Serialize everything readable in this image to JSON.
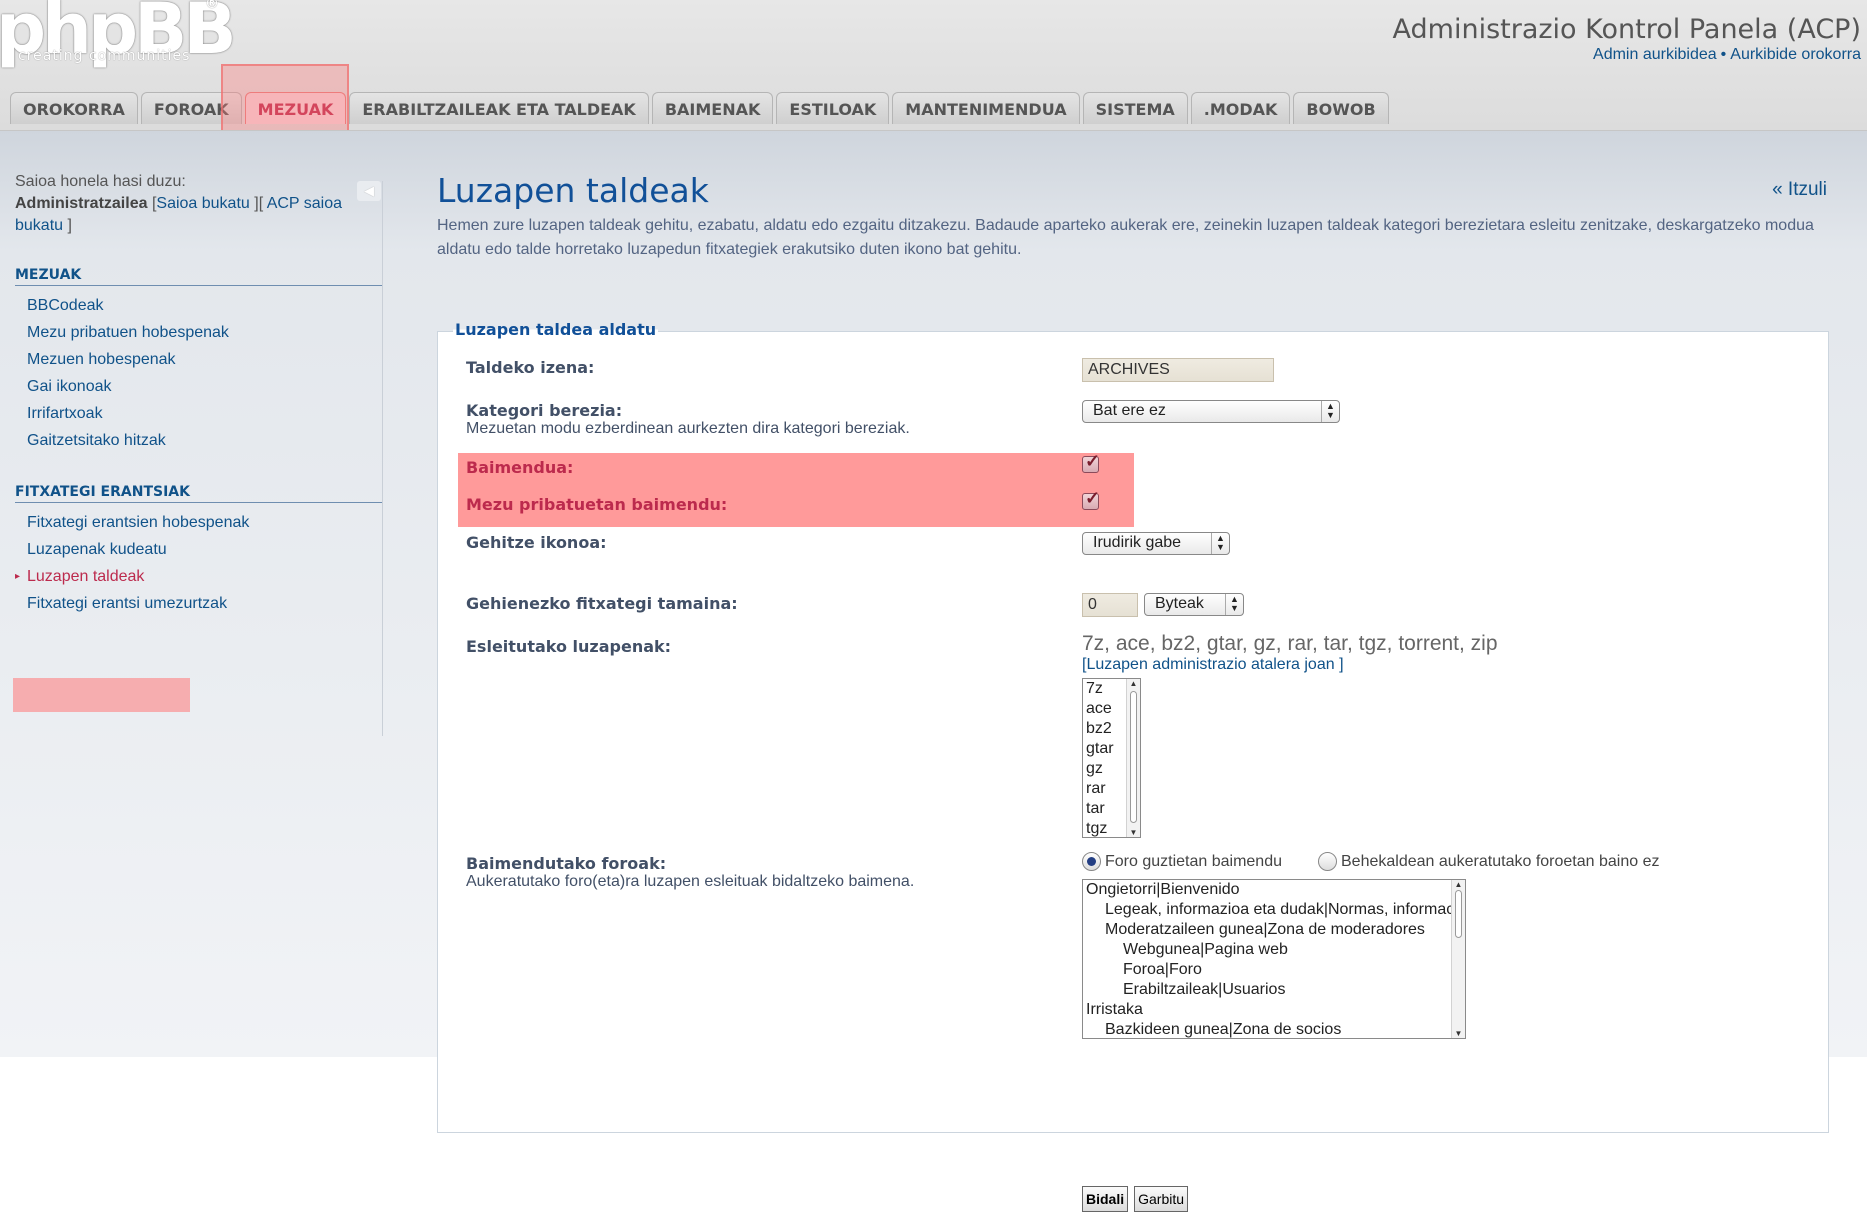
{
  "header": {
    "logo_text": "phpBB",
    "logo_reg": "®",
    "logo_tagline": "creating communities",
    "title": "Administrazio Kontrol Panela (ACP)",
    "links": [
      "Admin aurkibidea",
      "Aurkibide orokorra"
    ],
    "link_separator": "•"
  },
  "tabs": [
    {
      "label": "OROKORRA"
    },
    {
      "label": "FOROAK"
    },
    {
      "label": "MEZUAK",
      "active": true
    },
    {
      "label": "ERABILTZAILEAK ETA TALDEAK"
    },
    {
      "label": "BAIMENAK"
    },
    {
      "label": "ESTILOAK"
    },
    {
      "label": "MANTENIMENDUA"
    },
    {
      "label": "SISTEMA"
    },
    {
      "label": ".MODAK"
    },
    {
      "label": "BOWOB"
    }
  ],
  "sidebar": {
    "collapse_glyph": "◀",
    "login_prefix": "Saioa honela hasi duzu:",
    "username": "Administratzailea",
    "bracket_open": "[",
    "logout": "Saioa bukatu",
    "bracket_mid": "][",
    "acp_logout": "ACP saioa bukatu",
    "bracket_close": "]",
    "blocks": [
      {
        "heading": "MEZUAK",
        "items": [
          "BBCodeak",
          "Mezu pribatuen hobespenak",
          "Mezuen hobespenak",
          "Gai ikonoak",
          "Irrifartxoak",
          "Gaitzetsitako hitzak"
        ]
      },
      {
        "heading": "FITXATEGI ERANTSIAK",
        "items": [
          "Fitxategi erantsien hobespenak",
          "Luzapenak kudeatu",
          "Luzapen taldeak",
          "Fitxategi erantsi umezurtzak"
        ],
        "active_index": 2
      }
    ]
  },
  "main": {
    "title": "Luzapen taldeak",
    "back_link": "« Itzuli",
    "description": "Hemen zure luzapen taldeak gehitu, ezabatu, aldatu edo ezgaitu ditzakezu. Badaude aparteko aukerak ere, zeinekin luzapen taldeak kategori berezietara esleitu zenitzake, deskargatzeko modua aldatu edo talde horretako luzapedun fitxategiek erakutsiko duten ikono bat gehitu.",
    "fieldset_legend": "Luzapen taldea aldatu",
    "group_name_label": "Taldeko izena:",
    "group_name_value": "ARCHIVES",
    "special_category_label": "Kategori berezia:",
    "special_category_explain": "Mezuetan modu ezberdinean aurkezten dira kategori bereziak.",
    "special_category_value": "Bat ere ez",
    "allowed_label": "Baimendua:",
    "allowed_checked": true,
    "allowed_pm_label": "Mezu pribatuetan baimendu:",
    "allowed_pm_checked": true,
    "upload_icon_label": "Gehitze ikonoa:",
    "upload_icon_value": "Irudirik gabe",
    "max_size_label": "Gehienezko fitxategi tamaina:",
    "max_size_value": "0",
    "max_size_unit": "Byteak",
    "assigned_ext_label": "Esleitutako luzapenak:",
    "assigned_ext_text": "7z, ace, bz2, gtar, gz, rar, tar, tgz, torrent, zip",
    "ext_link_open": "[",
    "ext_link": "Luzapen administrazio atalera joan",
    "ext_link_close": "]",
    "ext_list": [
      "7z",
      "ace",
      "bz2",
      "gtar",
      "gz",
      "rar",
      "tar",
      "tgz"
    ],
    "allowed_forums_label": "Baimendutako foroak:",
    "allowed_forums_explain": "Aukeratutako foro(eta)ra luzapen esleituak bidaltzeko baimena.",
    "radio_all": "Foro guztietan baimendu",
    "radio_selected": "Behekaldean aukeratutako foroetan baino ez",
    "radio_checked": "all",
    "forums": [
      {
        "label": "Ongietorri|Bienvenido",
        "level": 0
      },
      {
        "label": "Legeak, informazioa eta dudak|Normas, informacion y dudas",
        "level": 1
      },
      {
        "label": "Moderatzaileen gunea|Zona de moderadores",
        "level": 1
      },
      {
        "label": "Webgunea|Pagina web",
        "level": 2
      },
      {
        "label": "Foroa|Foro",
        "level": 2
      },
      {
        "label": "Erabiltzaileak|Usuarios",
        "level": 2
      },
      {
        "label": "Irristaka",
        "level": 0
      },
      {
        "label": "Bazkideen gunea|Zona de socios",
        "level": 1
      }
    ],
    "submit_label": "Bidali",
    "reset_label": "Garbitu"
  },
  "colors": {
    "link": "#105289",
    "active_red": "#bc2a4d",
    "highlight": "#ff7878"
  }
}
